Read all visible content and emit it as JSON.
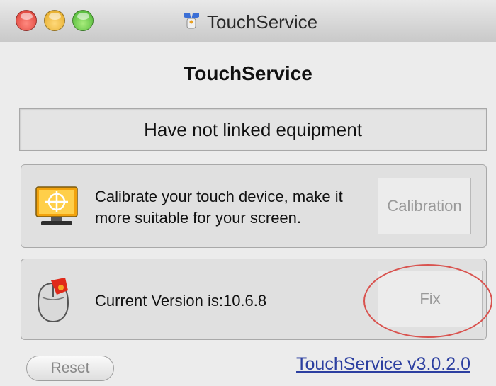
{
  "window": {
    "title": "TouchService",
    "app_icon": "touchservice-app-icon",
    "traffic_lights": [
      "close",
      "minimize",
      "zoom"
    ]
  },
  "main": {
    "heading": "TouchService",
    "status_text": "Have not linked equipment"
  },
  "calibration": {
    "icon": "monitor-crosshair-icon",
    "description": "Calibrate your touch device, make it more suitable for your screen.",
    "button_label": "Calibration"
  },
  "version": {
    "icon": "mouse-icon",
    "text": "Current Version is:10.6.8",
    "button_label": "Fix",
    "highlight_color": "#d9534f"
  },
  "footer": {
    "reset_label": "Reset",
    "version_link": "TouchService v3.0.2.0"
  }
}
